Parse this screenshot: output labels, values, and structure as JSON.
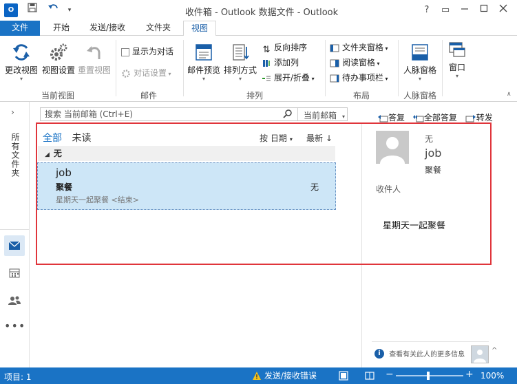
{
  "titlebar": {
    "app_icon_text": "O",
    "title": "收件箱 - Outlook 数据文件 - Outlook",
    "help_label": "?",
    "restore_label": "▭"
  },
  "tabs": [
    "文件",
    "开始",
    "发送/接收",
    "文件夹",
    "视图"
  ],
  "ribbon": {
    "change_view": "更改视图",
    "view_settings": "视图设置",
    "reset_view": "重置视图",
    "current_view_group": "当前视图",
    "show_as_conversations": "显示为对话",
    "conversation_settings": "对话设置",
    "messages_group": "邮件",
    "message_preview": "邮件预览",
    "arrangement": "排列方式",
    "reverse_sort": "反向排序",
    "add_columns": "添加列",
    "expand_collapse": "展开/折叠",
    "arrangement_group": "排列",
    "folder_pane": "文件夹窗格",
    "reading_pane": "阅读窗格",
    "todo_bar": "待办事项栏",
    "layout_group": "布局",
    "people_pane": "人脉窗格",
    "people_pane_group": "人脉窗格",
    "window": "窗口"
  },
  "leftnav": {
    "all_folders": "所有文件夹"
  },
  "search": {
    "placeholder": "搜索 当前邮箱 (Ctrl+E)",
    "scope": "当前邮箱"
  },
  "actions": {
    "reply": "答复",
    "reply_all": "全部答复",
    "forward": "转发"
  },
  "list": {
    "filter_all": "全部",
    "filter_unread": "未读",
    "sort_by": "按 日期",
    "sort_order": "最新",
    "group_label": "无",
    "items": [
      {
        "sender": "job",
        "subject": "聚餐",
        "preview": "星期天一起聚餐 <结束>",
        "category": "无"
      }
    ]
  },
  "reading": {
    "category": "无",
    "sender": "job",
    "subject": "聚餐",
    "to_label": "收件人",
    "body": "星期天一起聚餐",
    "info_text": "查看有关此人的更多信息"
  },
  "statusbar": {
    "items": "项目: 1",
    "warning": "发送/接收错误",
    "zoom": "100%"
  },
  "colors": {
    "accent": "#1a73c5",
    "selection": "#cde6f7",
    "highlight_box": "#e0353b"
  }
}
